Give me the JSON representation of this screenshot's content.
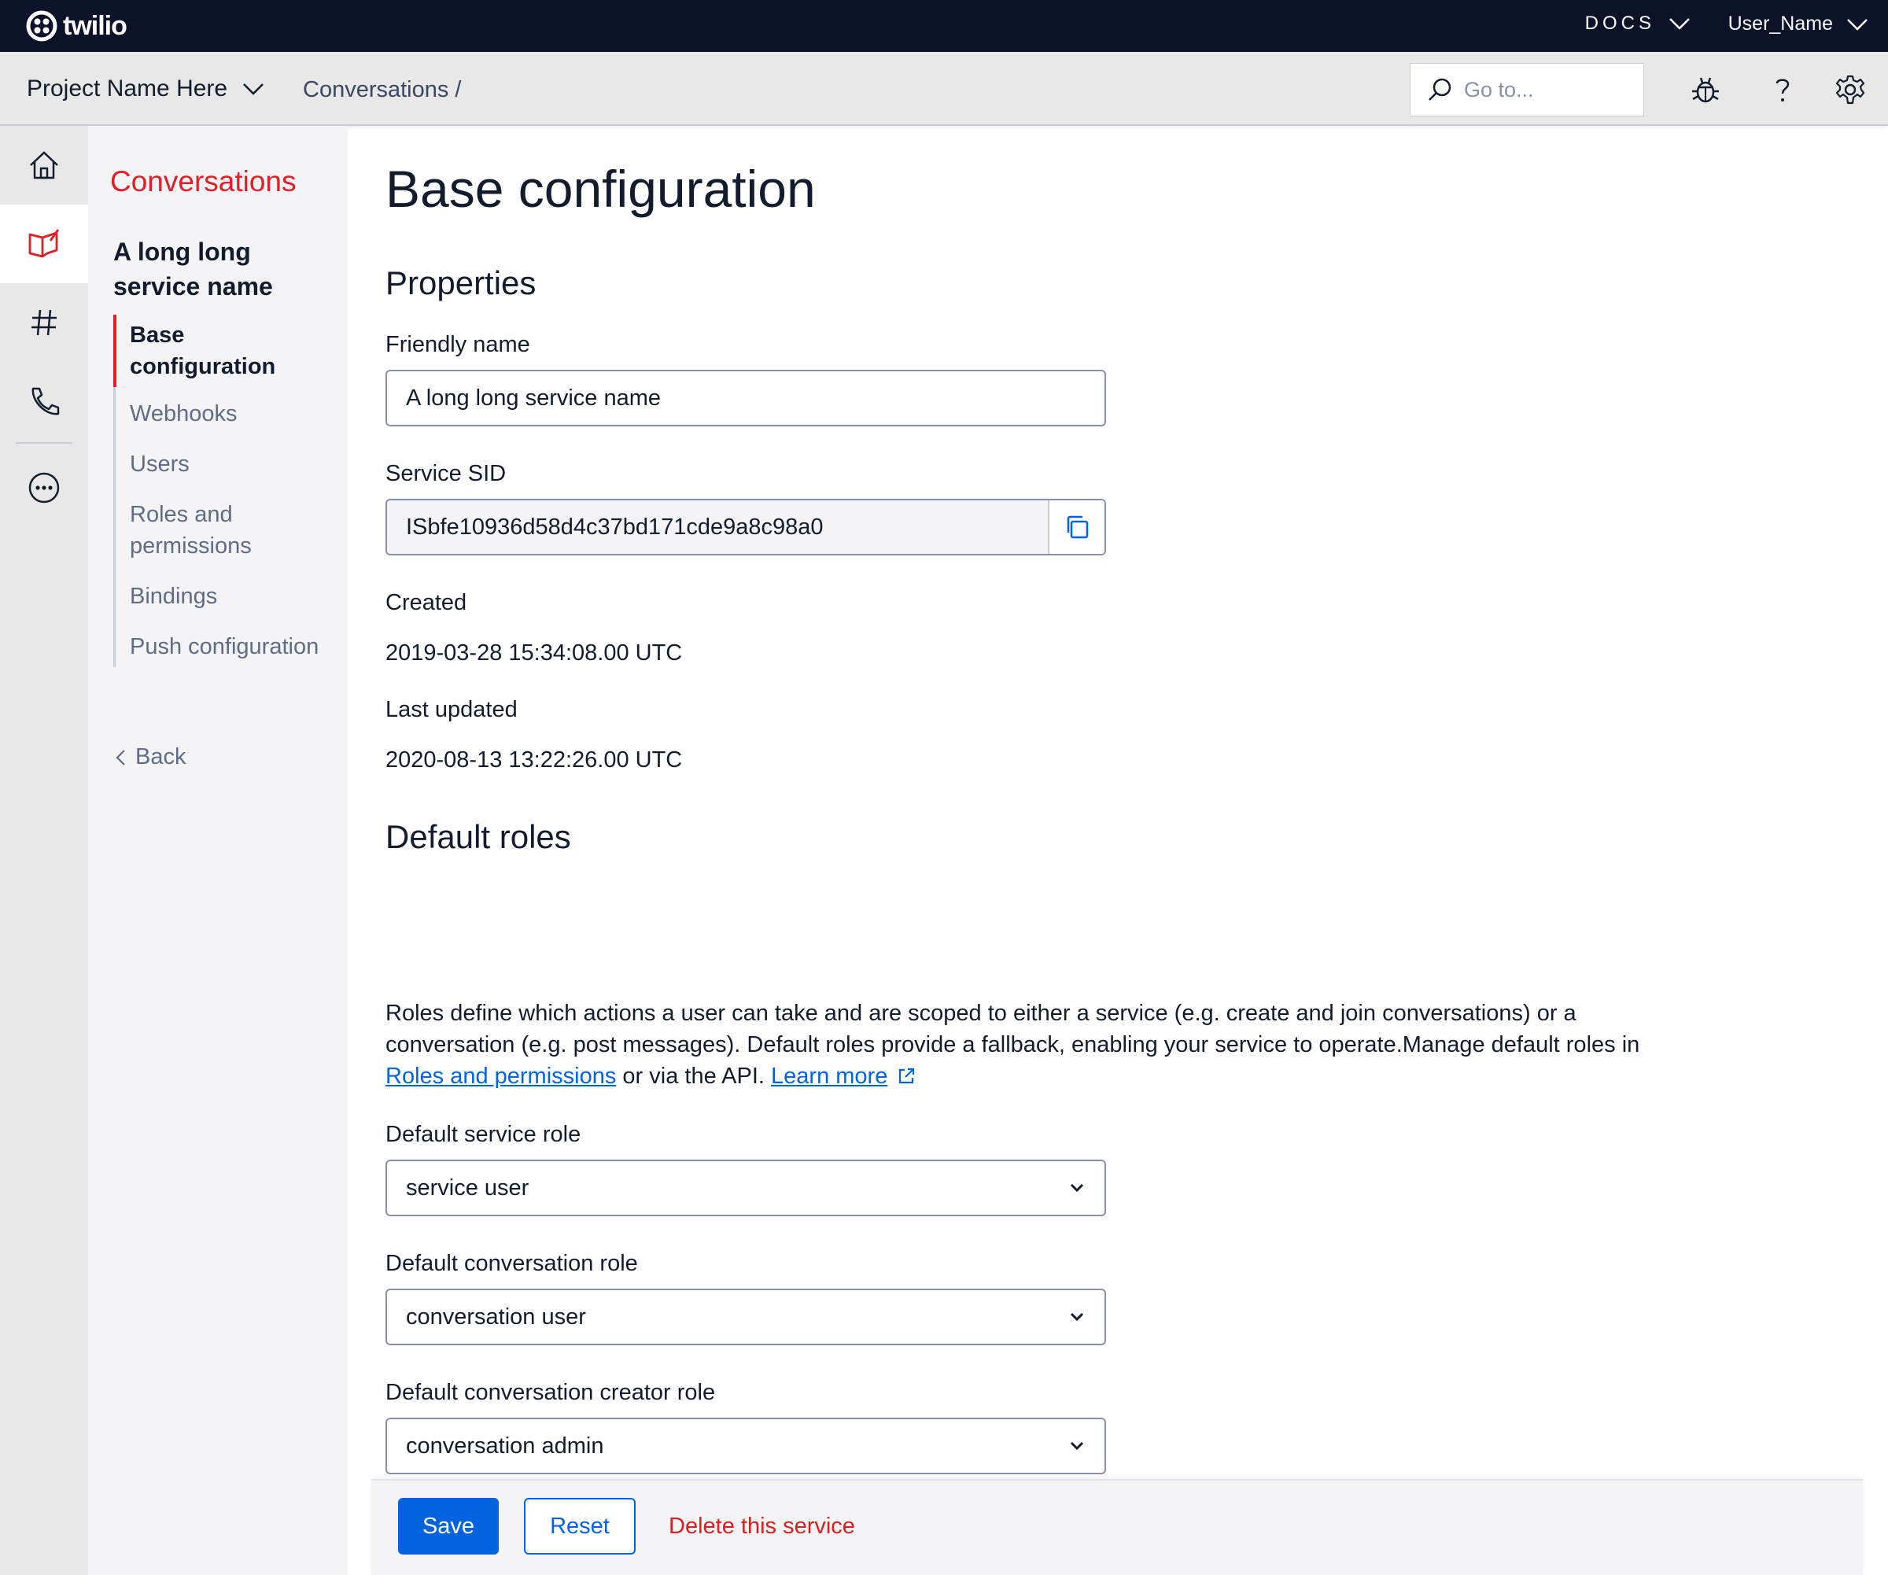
{
  "colors": {
    "topbar_bg": "#0d122b",
    "brand_red": "#e31e26",
    "link_blue": "#0263e0",
    "danger_red": "#d61f1f"
  },
  "topbar": {
    "logo_text": "twilio",
    "docs_label": "DOCS",
    "user_label": "User_Name"
  },
  "subbar": {
    "project_name": "Project Name Here",
    "breadcrumb": "Conversations /",
    "search_placeholder": "Go to...",
    "icons": [
      "debugger-bug-icon",
      "help-question-icon",
      "settings-gear-icon"
    ]
  },
  "rail": {
    "items": [
      {
        "icon": "home-icon",
        "active": false
      },
      {
        "icon": "conversations-icon",
        "active": true
      },
      {
        "icon": "hash-icon",
        "active": false
      },
      {
        "icon": "phone-icon",
        "active": false
      },
      {
        "icon": "more-icon",
        "active": false
      }
    ]
  },
  "nav": {
    "section_title": "Conversations",
    "service_name": "A long long service name",
    "items": [
      {
        "label": "Base configuration",
        "active": true
      },
      {
        "label": "Webhooks",
        "active": false
      },
      {
        "label": "Users",
        "active": false
      },
      {
        "label": "Roles and permissions",
        "active": false
      },
      {
        "label": "Bindings",
        "active": false
      },
      {
        "label": "Push configuration",
        "active": false
      }
    ],
    "back_label": "Back"
  },
  "main": {
    "title": "Base configuration",
    "properties_heading": "Properties",
    "friendly_name_label": "Friendly name",
    "friendly_name_value": "A long long service name",
    "service_sid_label": "Service SID",
    "service_sid_value": "ISbfe10936d58d4c37bd171cde9a8c98a0",
    "created_label": "Created",
    "created_value": "2019-03-28 15:34:08.00 UTC",
    "last_updated_label": "Last updated",
    "last_updated_value": "2020-08-13 13:22:26.00 UTC",
    "default_roles_heading": "Default roles",
    "description_part1": "Roles define which actions a user can take and are scoped to either a service (e.g. create and join conversations) or a conversation (e.g. post messages). Default roles provide a fallback, enabling your service to operate.Manage default roles in",
    "description_link1": "Roles and permissions",
    "description_part2": "or via the API.",
    "description_link2": "Learn more",
    "service_role_label": "Default service role",
    "service_role_value": "service user",
    "conversation_role_label": "Default conversation role",
    "conversation_role_value": "conversation user",
    "creator_role_label": "Default conversation creator role",
    "creator_role_value": "conversation admin"
  },
  "footer": {
    "save_label": "Save",
    "reset_label": "Reset",
    "delete_label": "Delete this service"
  }
}
